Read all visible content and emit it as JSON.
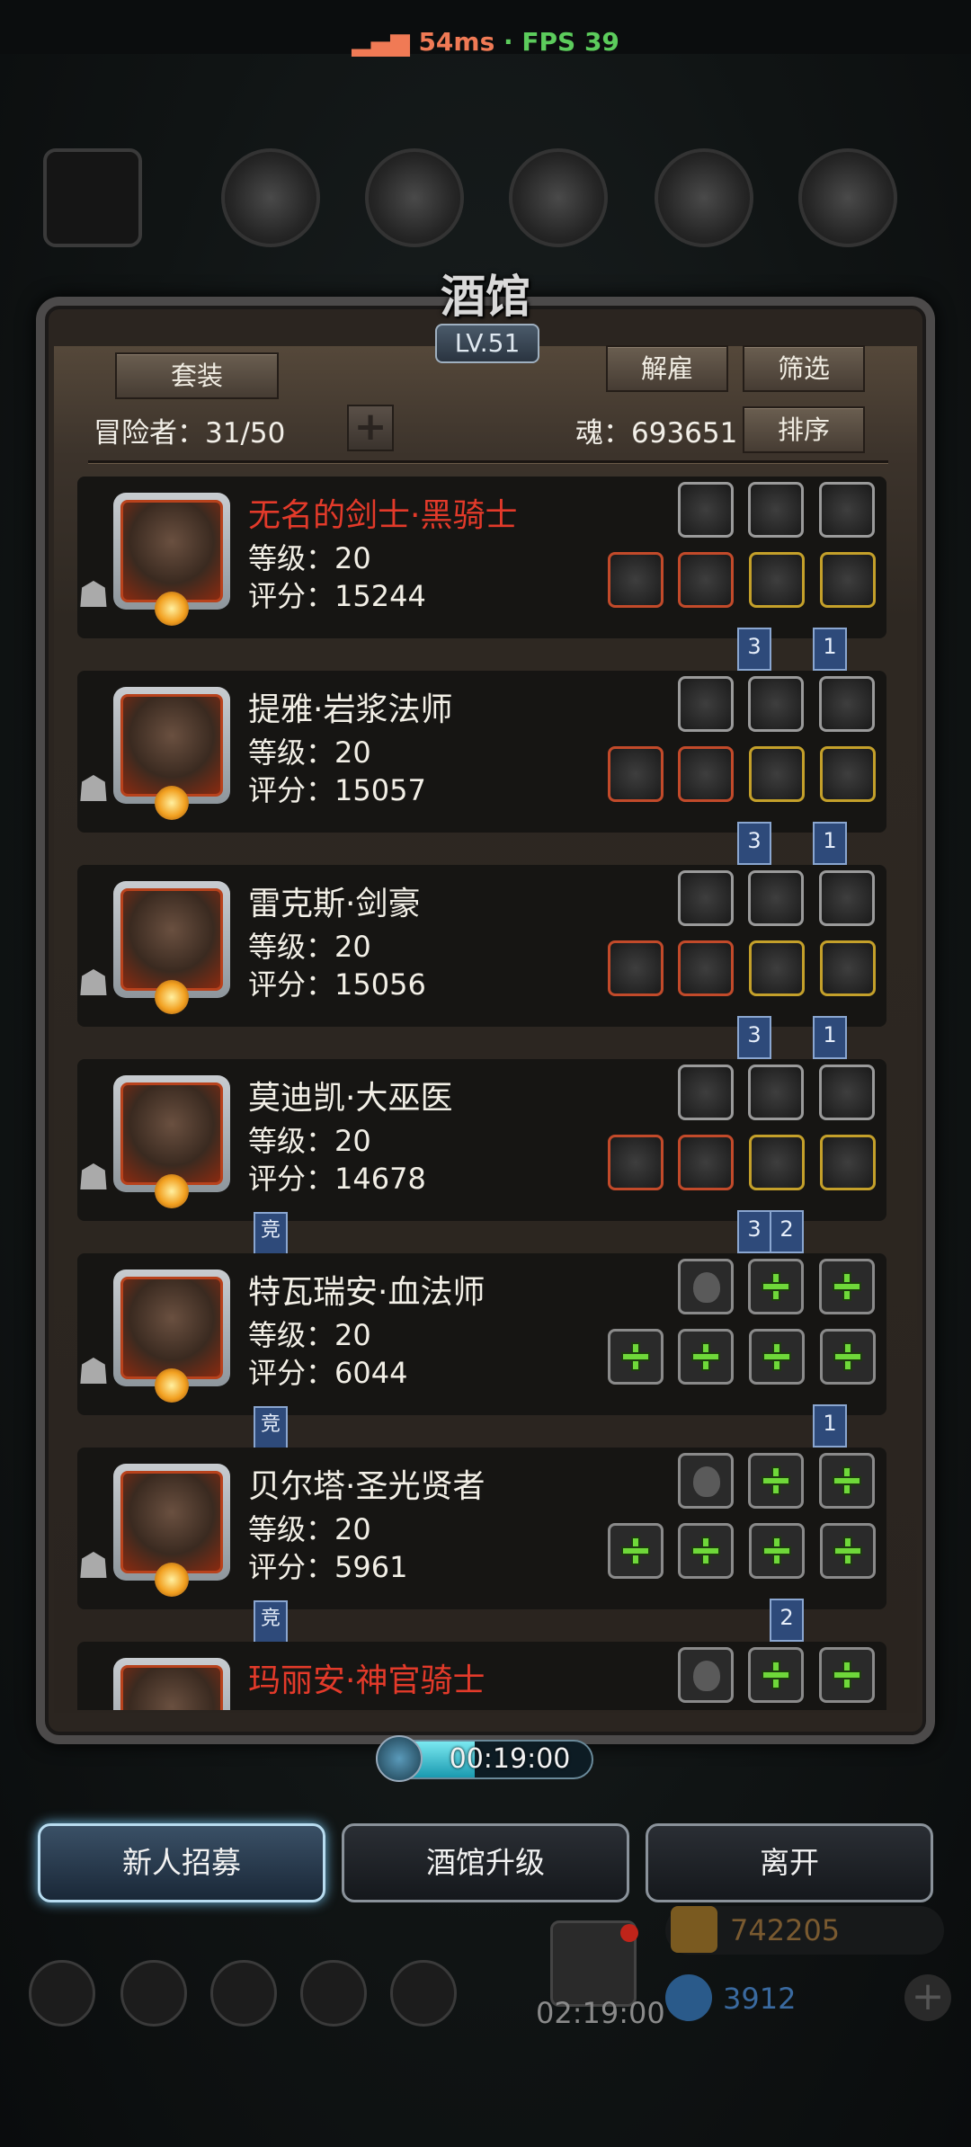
{
  "status": {
    "ping": "54ms",
    "sep": " · ",
    "fps": "FPS 39"
  },
  "header": {
    "title": "酒馆",
    "level": "LV.51"
  },
  "buttons": {
    "outfit": "套装",
    "dismiss": "解雇",
    "filter": "筛选",
    "sort": "排序"
  },
  "adventurers_label": "冒险者：31/50",
  "soul_label": "魂：693651",
  "heroes": [
    {
      "name": "无名的剑士·黑骑士",
      "name_color": "red",
      "level": "等级：20",
      "score": "评分：15244",
      "top_slots": [
        "crystal-icon",
        "drum-icon",
        "fish-icon"
      ],
      "bottom_slots": [
        "sword-icon",
        "scroll-icon",
        "shield-icon",
        "heart-gem-icon"
      ],
      "flags": [
        "3",
        "1"
      ],
      "tag": ""
    },
    {
      "name": "提雅·岩浆法师",
      "name_color": "white",
      "level": "等级：20",
      "score": "评分：15057",
      "top_slots": [
        "orb-icon",
        "lantern-icon",
        "rune-icon"
      ],
      "bottom_slots": [
        "staff-icon",
        "armor-icon",
        "wings-icon",
        "eye-icon"
      ],
      "flags": [
        "3",
        "1"
      ],
      "tag": ""
    },
    {
      "name": "雷克斯·剑豪",
      "name_color": "white",
      "level": "等级：20",
      "score": "评分：15056",
      "top_slots": [
        "fire-icon",
        "bomb-icon",
        "meat-icon"
      ],
      "bottom_slots": [
        "blade-icon",
        "armor-icon",
        "rose-icon",
        "box-icon"
      ],
      "flags": [
        "3",
        "1"
      ],
      "tag": ""
    },
    {
      "name": "莫迪凯·大巫医",
      "name_color": "white",
      "level": "等级：20",
      "score": "评分：14678",
      "top_slots": [
        "crystal-icon",
        "flower-icon",
        "lantern-icon"
      ],
      "bottom_slots": [
        "dagger-icon",
        "helmet-icon",
        "horse-icon",
        "mask-icon"
      ],
      "flags": [
        "3",
        "2"
      ],
      "tag": "竞"
    },
    {
      "name": "特瓦瑞安·血法师",
      "name_color": "white",
      "level": "等级：20",
      "score": "评分：6044",
      "top_slots": [
        "empty-flame",
        "add",
        "add"
      ],
      "bottom_slots": [
        "add",
        "add",
        "add",
        "add"
      ],
      "flags": [
        "1"
      ],
      "tag": "竞"
    },
    {
      "name": "贝尔塔·圣光贤者",
      "name_color": "white",
      "level": "等级：20",
      "score": "评分：5961",
      "top_slots": [
        "empty-flame",
        "add",
        "add"
      ],
      "bottom_slots": [
        "add",
        "add",
        "add",
        "add"
      ],
      "flags": [
        "2"
      ],
      "tag": "竞"
    },
    {
      "name": "玛丽安·神官骑士",
      "name_color": "red",
      "level": "",
      "score": "",
      "top_slots": [
        "empty-flame",
        "add",
        "add"
      ],
      "bottom_slots": [],
      "flags": [],
      "tag": ""
    }
  ],
  "timer": {
    "value": "00:19:00",
    "progress": 0.45
  },
  "bottom_buttons": {
    "recruit": "新人招募",
    "upgrade": "酒馆升级",
    "leave": "离开"
  },
  "resources": {
    "gold": "742205",
    "gems": "3912",
    "gift_timer": "02:19:00"
  },
  "colors": {
    "accent_red": "#e33a2a",
    "plus_green": "#6fd83a",
    "flag_blue": "#2e4a7a",
    "ping": "#f07a55",
    "fps": "#5ccc5c"
  }
}
